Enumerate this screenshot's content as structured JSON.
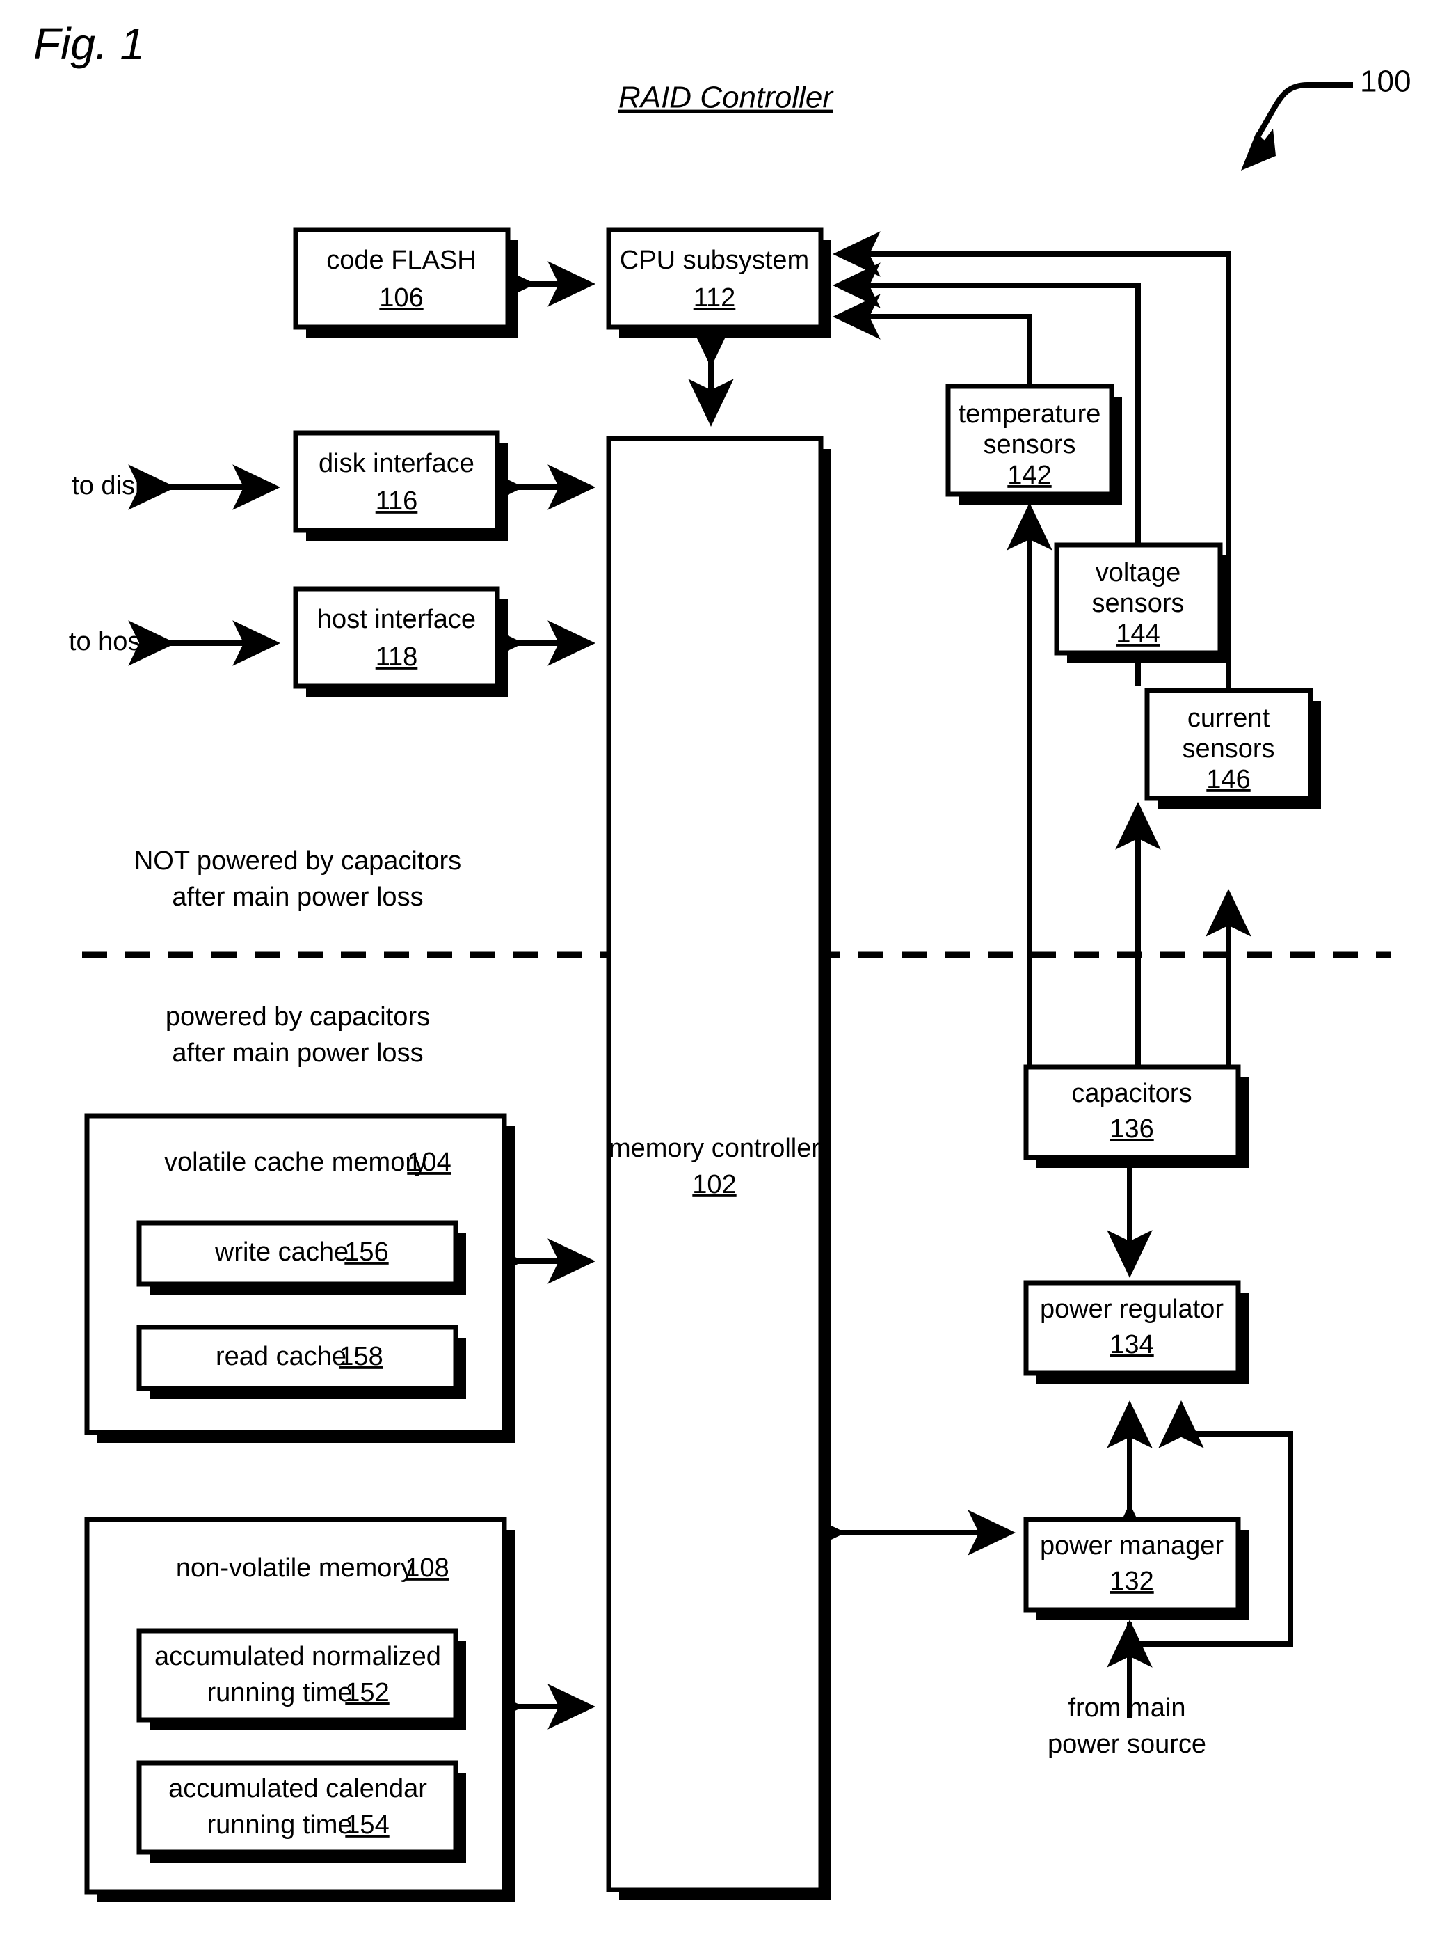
{
  "figure": {
    "figure_label": "Fig. 1",
    "title": "RAID Controller",
    "reference_numeral": "100"
  },
  "annotations": {
    "to_disks": "to disks",
    "to_hosts": "to hosts",
    "not_powered_line1": "NOT powered by capacitors",
    "not_powered_line2": "after main power loss",
    "powered_line1": "powered by capacitors",
    "powered_line2": "after main power loss",
    "from_main_line1": "from main",
    "from_main_line2": "power source"
  },
  "blocks": {
    "code_flash": {
      "label": "code FLASH",
      "ref": "106"
    },
    "cpu_subsystem": {
      "label": "CPU subsystem",
      "ref": "112"
    },
    "disk_interface": {
      "label": "disk interface",
      "ref": "116"
    },
    "host_interface": {
      "label": "host interface",
      "ref": "118"
    },
    "memory_controller": {
      "label": "memory controller",
      "ref": "102"
    },
    "temperature_sensors": {
      "label_line1": "temperature",
      "label_line2": "sensors",
      "ref": "142"
    },
    "voltage_sensors": {
      "label_line1": "voltage",
      "label_line2": "sensors",
      "ref": "144"
    },
    "current_sensors": {
      "label_line1": "current",
      "label_line2": "sensors",
      "ref": "146"
    },
    "capacitors": {
      "label": "capacitors",
      "ref": "136"
    },
    "power_regulator": {
      "label": "power regulator",
      "ref": "134"
    },
    "power_manager": {
      "label": "power manager",
      "ref": "132"
    },
    "volatile_cache_memory": {
      "label": "volatile cache memory",
      "ref": "104"
    },
    "write_cache": {
      "label": "write cache",
      "ref": "156"
    },
    "read_cache": {
      "label": "read cache",
      "ref": "158"
    },
    "non_volatile_memory": {
      "label": "non-volatile memory",
      "ref": "108"
    },
    "accumulated_normalized_running_time": {
      "label_line1": "accumulated normalized",
      "label_line2": "running time",
      "ref": "152"
    },
    "accumulated_calendar_running_time": {
      "label_line1": "accumulated calendar",
      "label_line2": "running time",
      "ref": "154"
    }
  },
  "colors": {
    "ink": "#000000",
    "paper": "#ffffff"
  }
}
